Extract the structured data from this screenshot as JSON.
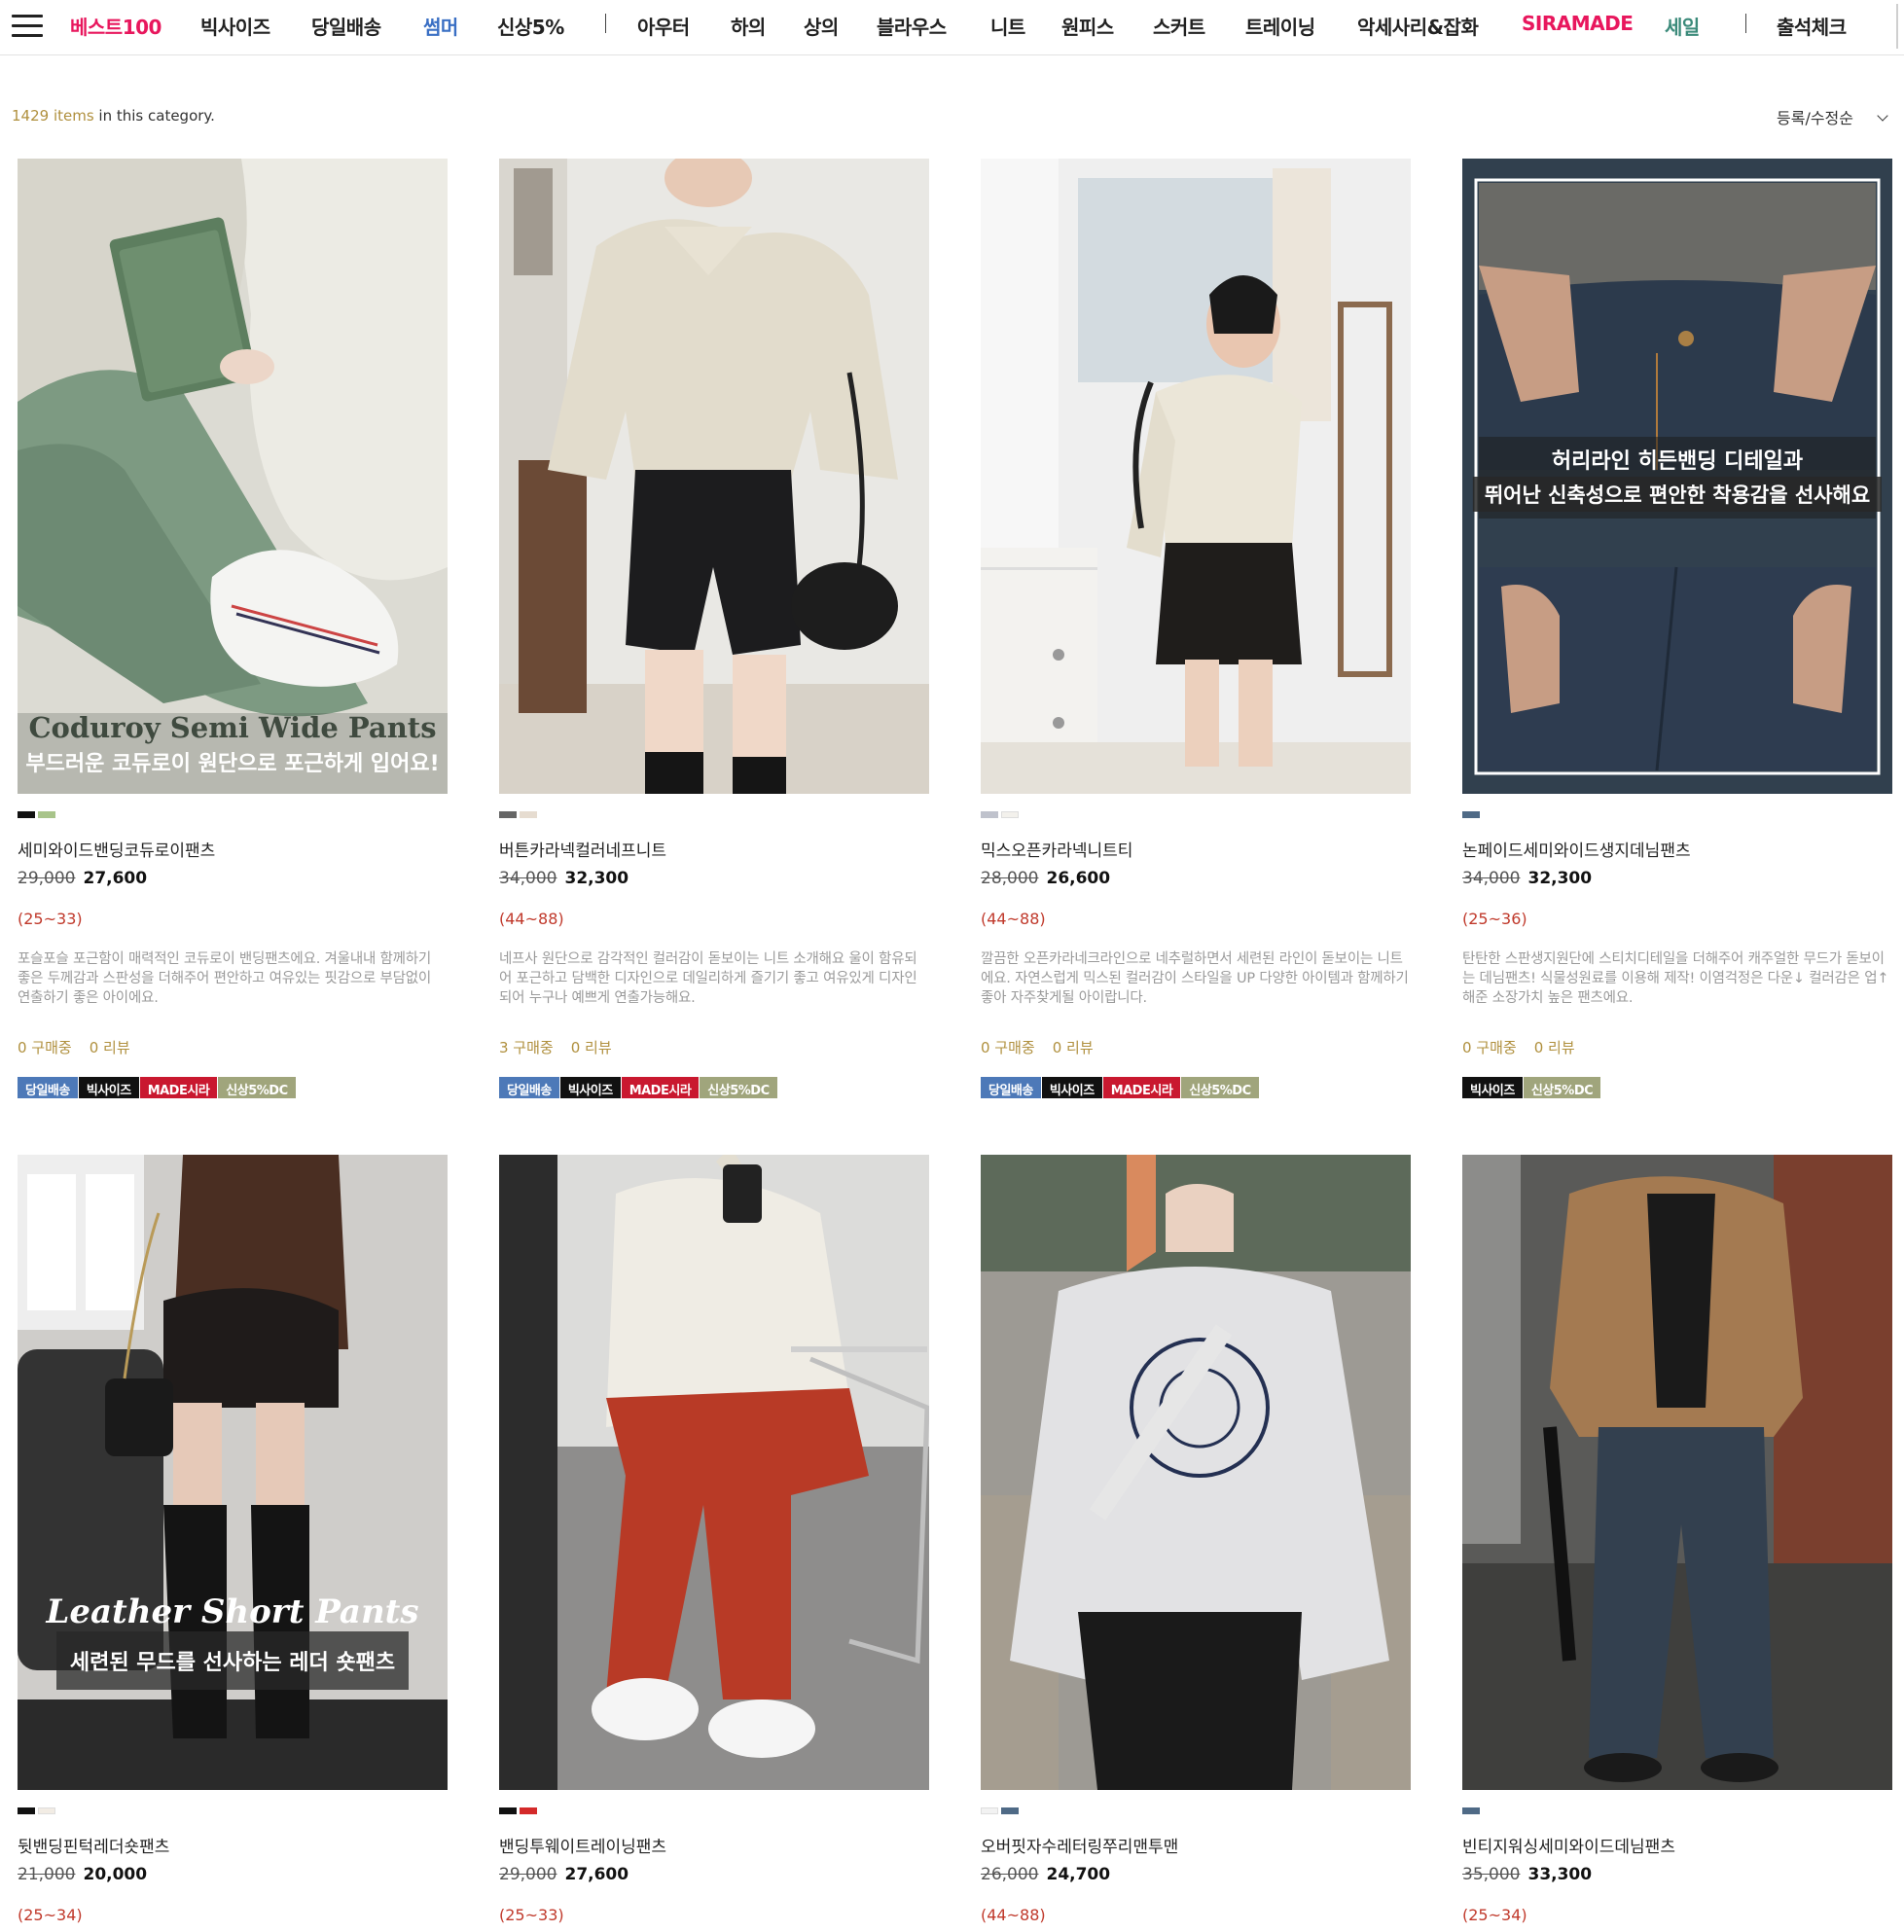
{
  "nav": {
    "items": [
      {
        "label": "베스트100",
        "color": "#e8175d"
      },
      {
        "label": "빅사이즈",
        "color": "#222222"
      },
      {
        "label": "당일배송",
        "color": "#222222"
      },
      {
        "label": "썸머",
        "color": "#3a6fc4"
      },
      {
        "label": "신상5%",
        "color": "#222222"
      },
      {
        "label": "아우터",
        "color": "#222222"
      },
      {
        "label": "하의",
        "color": "#222222"
      },
      {
        "label": "상의",
        "color": "#222222"
      },
      {
        "label": "블라우스",
        "color": "#222222"
      },
      {
        "label": "니트",
        "color": "#222222"
      },
      {
        "label": "원피스",
        "color": "#222222"
      },
      {
        "label": "스커트",
        "color": "#222222"
      },
      {
        "label": "트레이닝",
        "color": "#222222"
      },
      {
        "label": "악세사리&잡화",
        "color": "#222222"
      },
      {
        "label": "SIRAMADE",
        "color": "#e8175d"
      },
      {
        "label": "세일",
        "color": "#3b8a7a"
      },
      {
        "label": "출석체크",
        "color": "#222222"
      }
    ]
  },
  "category": {
    "count": "1429 items",
    "suffix": " in this category.",
    "sort_label": "등록/수정순"
  },
  "products": [
    {
      "name": "세미와이드밴딩코듀로이팬츠",
      "old_price": "29,000",
      "price": "27,600",
      "size": "(25~33)",
      "desc": "포슬포슬 포근함이 매력적인 코듀로이 밴딩팬츠에요. 겨울내내 함께하기 좋은 두께감과 스판성을 더해주어 편안하고 여유있는 핏감으로 부담없이 연출하기 좋은 아이에요.",
      "purchases": "0 구매중",
      "reviews": "0 리뷰",
      "swatches": [
        "#111111",
        "#a8c48a"
      ],
      "badges": [
        {
          "label": "당일배송",
          "cls": "b-blue"
        },
        {
          "label": "빅사이즈",
          "cls": "b-black"
        },
        {
          "label": "MADE시라",
          "cls": "b-red"
        },
        {
          "label": "신상5%DC",
          "cls": "b-olive"
        }
      ],
      "caption_en": "Coduroy Semi Wide Pants",
      "caption_kr": "부드러운 코듀로이 원단으로 포근하게 입어요!"
    },
    {
      "name": "버튼카라넥컬러네프니트",
      "old_price": "34,000",
      "price": "32,300",
      "size": "(44~88)",
      "desc": "네프사 원단으로 감각적인 컬러감이 돋보이는 니트 소개해요 울이 함유되어 포근하고 담백한 디자인으로 데일리하게 즐기기 좋고 여유있게 디자인되어 누구나 예쁘게 연출가능해요.",
      "purchases": "3 구매중",
      "reviews": "0 리뷰",
      "swatches": [
        "#666666",
        "#e6dcd0"
      ],
      "badges": [
        {
          "label": "당일배송",
          "cls": "b-blue"
        },
        {
          "label": "빅사이즈",
          "cls": "b-black"
        },
        {
          "label": "MADE시라",
          "cls": "b-red"
        },
        {
          "label": "신상5%DC",
          "cls": "b-olive"
        }
      ]
    },
    {
      "name": "믹스오픈카라넥니트티",
      "old_price": "28,000",
      "price": "26,600",
      "size": "(44~88)",
      "desc": "깔끔한 오픈카라네크라인으로 네추럴하면서 세련된 라인이 돋보이는 니트에요. 자연스럽게 믹스된 컬러감이 스타일을 UP 다양한 아이템과 함께하기 좋아 자주찾게될 아이랍니다.",
      "purchases": "0 구매중",
      "reviews": "0 리뷰",
      "swatches": [
        "#bfc2cc",
        "#f3f1ec"
      ],
      "badges": [
        {
          "label": "당일배송",
          "cls": "b-blue"
        },
        {
          "label": "빅사이즈",
          "cls": "b-black"
        },
        {
          "label": "MADE시라",
          "cls": "b-red"
        },
        {
          "label": "신상5%DC",
          "cls": "b-olive"
        }
      ]
    },
    {
      "name": "논페이드세미와이드생지데님팬츠",
      "old_price": "34,000",
      "price": "32,300",
      "size": "(25~36)",
      "desc": "탄탄한 스판생지원단에 스티치디테일을 더해주어 캐주얼한 무드가 돋보이는 데님팬츠! 식물성원료를 이용해 제작! 이염걱정은 다운↓ 컬러감은 업↑ 해준 소장가치 높은 팬츠에요.",
      "purchases": "0 구매중",
      "reviews": "0 리뷰",
      "swatches": [
        "#4f6a86"
      ],
      "badges": [
        {
          "label": "빅사이즈",
          "cls": "b-black"
        },
        {
          "label": "신상5%DC",
          "cls": "b-olive"
        }
      ],
      "caption_kr_1": "허리라인 히든밴딩 디테일과",
      "caption_kr_2": "뛰어난 신축성으로 편안한 착용감을 선사해요"
    },
    {
      "name": "뒷밴딩핀턱레더숏팬츠",
      "old_price": "21,000",
      "price": "20,000",
      "size": "(25~34)",
      "swatches": [
        "#111111",
        "#f2ece4"
      ],
      "caption_en": "Leather Short Pants",
      "caption_kr": "세련된 무드를 선사하는 레더 숏팬츠"
    },
    {
      "name": "밴딩투웨이트레이닝팬츠",
      "old_price": "29,000",
      "price": "27,600",
      "size": "(25~33)",
      "swatches": [
        "#111111",
        "#d42a2a"
      ]
    },
    {
      "name": "오버핏자수레터링쭈리맨투맨",
      "old_price": "26,000",
      "price": "24,700",
      "size": "(44~88)",
      "swatches": [
        "#f2f2f2",
        "#4f6a86"
      ]
    },
    {
      "name": "빈티지워싱세미와이드데님팬츠",
      "old_price": "35,000",
      "price": "33,300",
      "size": "(25~34)",
      "swatches": [
        "#4f6a86"
      ]
    }
  ]
}
